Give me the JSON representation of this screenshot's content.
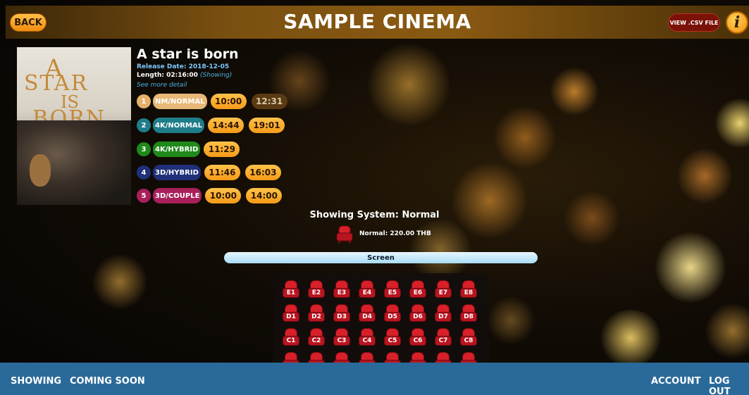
{
  "header": {
    "back_label": "BACK",
    "title": "SAMPLE CINEMA",
    "csv_label": "VIEW .CSV FILE",
    "info_glyph": "i"
  },
  "poster": {
    "line1": "A",
    "line2": "STAR",
    "line3": "IS",
    "line4": "BORN"
  },
  "movie": {
    "title": "A star is born",
    "release": "Release Date: 2018-12-05",
    "length_prefix": "Length: 02:16:00 ",
    "status": "(Showing)",
    "see_more": "See more detail"
  },
  "systems": [
    {
      "num": "1",
      "label": "NM/NORMAL",
      "num_color": "#e6b06a",
      "label_color": "#e8b878",
      "times": [
        "10:00",
        "12:31"
      ],
      "past": [
        false,
        true
      ]
    },
    {
      "num": "2",
      "label": "4K/NORMAL",
      "num_color": "#1f7d8a",
      "label_color": "#1f7d8a",
      "times": [
        "14:44",
        "19:01"
      ],
      "past": [
        false,
        false
      ]
    },
    {
      "num": "3",
      "label": "4K/HYBRID",
      "num_color": "#1f8a1a",
      "label_color": "#1f8a1a",
      "times": [
        "11:29"
      ],
      "past": [
        false
      ]
    },
    {
      "num": "4",
      "label": "3D/HYBRID",
      "num_color": "#20307a",
      "label_color": "#20307a",
      "times": [
        "11:46",
        "16:03"
      ],
      "past": [
        false,
        false
      ]
    },
    {
      "num": "5",
      "label": "3D/COUPLE",
      "num_color": "#a8205a",
      "label_color": "#a8205a",
      "times": [
        "10:00",
        "14:00"
      ],
      "past": [
        false,
        false
      ]
    }
  ],
  "showing": {
    "system": "Showing System: Normal",
    "price": "Normal: 220.00 THB"
  },
  "screen_label": "Screen",
  "seats": {
    "rows": [
      [
        "E1",
        "E2",
        "E3",
        "E4",
        "E5",
        "E6",
        "E7",
        "E8"
      ],
      [
        "D1",
        "D2",
        "D3",
        "D4",
        "D5",
        "D6",
        "D7",
        "D8"
      ],
      [
        "C1",
        "C2",
        "C3",
        "C4",
        "C5",
        "C6",
        "C7",
        "C8"
      ],
      [
        "",
        "",
        "",
        "",
        "",
        "",
        "",
        ""
      ]
    ]
  },
  "footer": {
    "showing": "SHOWING",
    "coming_soon": "COMING SOON",
    "account": "ACCOUNT",
    "logout": "LOG OUT"
  }
}
